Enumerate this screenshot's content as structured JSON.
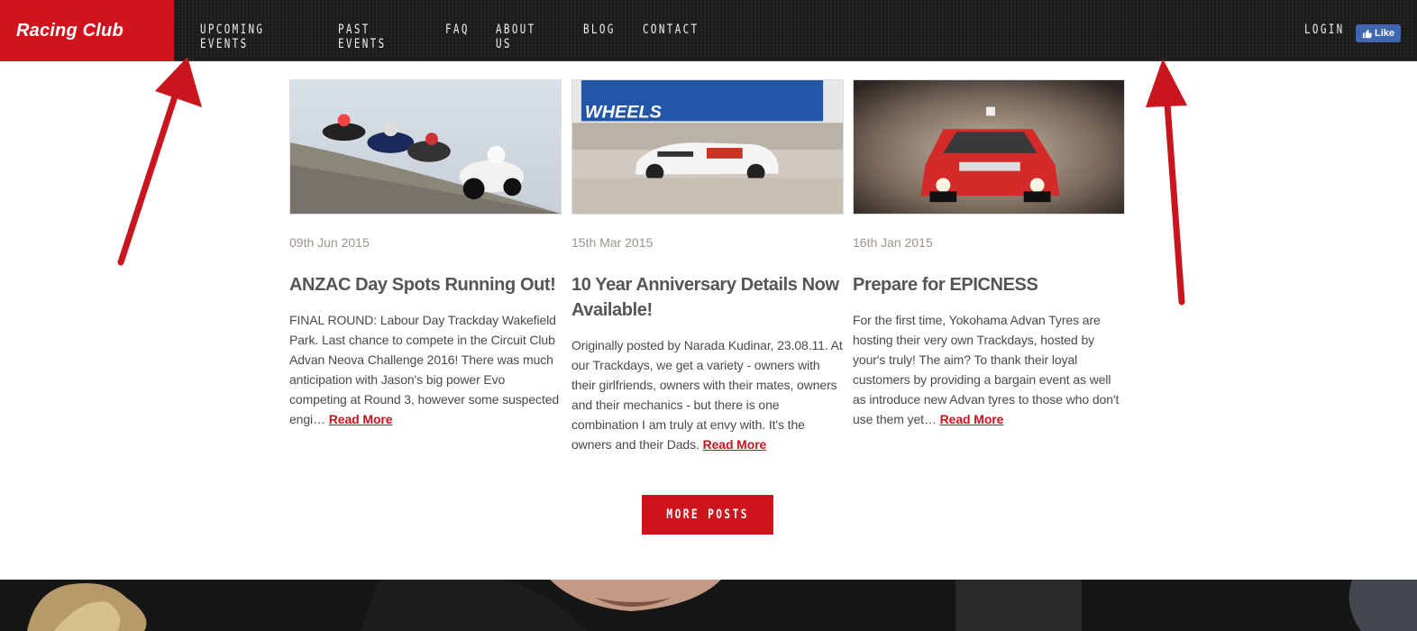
{
  "brand": {
    "name": "Racing Club"
  },
  "nav": {
    "items": [
      {
        "label": "UPCOMING EVENTS"
      },
      {
        "label": "PAST EVENTS"
      },
      {
        "label": "FAQ"
      },
      {
        "label": "ABOUT US"
      },
      {
        "label": "BLOG"
      },
      {
        "label": "CONTACT"
      }
    ],
    "login": "LOGIN",
    "fb_like": "Like"
  },
  "posts": [
    {
      "date": "09th Jun 2015",
      "title": "ANZAC Day Spots Running Out!",
      "excerpt": "FINAL ROUND: Labour Day Trackday Wakefield Park. Last chance to compete in the Circuit Club Advan Neova Challenge 2016! There was much anticipation with Jason's big power Evo competing at Round 3, however some suspected engi…",
      "read_more": "Read More",
      "image": "motorcycles-racing-photo"
    },
    {
      "date": "15th Mar 2015",
      "title": "10 Year Anniversary Details Now Available!",
      "excerpt": "Originally posted by Narada Kudinar, 23.08.11. At our Trackdays, we get a variety - owners with their girlfriends, owners with their mates, owners and their mechanics - but there is one combination I am truly at envy with. It's the owners and their Dads.",
      "read_more": "Read More",
      "image": "le-mans-prototype-car-photo"
    },
    {
      "date": "16th Jan 2015",
      "title": "Prepare for EPICNESS",
      "excerpt": "For the first time, Yokohama Advan Tyres are hosting their very own Trackdays, hosted by your's truly! The aim? To thank their loyal customers by providing a bargain event as well as introduce new Advan tyres to those who don't use them yet…",
      "read_more": "Read More",
      "image": "red-rally-car-photo"
    }
  ],
  "more_posts_label": "MORE POSTS",
  "colors": {
    "brand_red": "#d0141e",
    "nav_bg": "#1c1c1c",
    "link_red": "#c8141c",
    "date_gray": "#9b948a"
  }
}
